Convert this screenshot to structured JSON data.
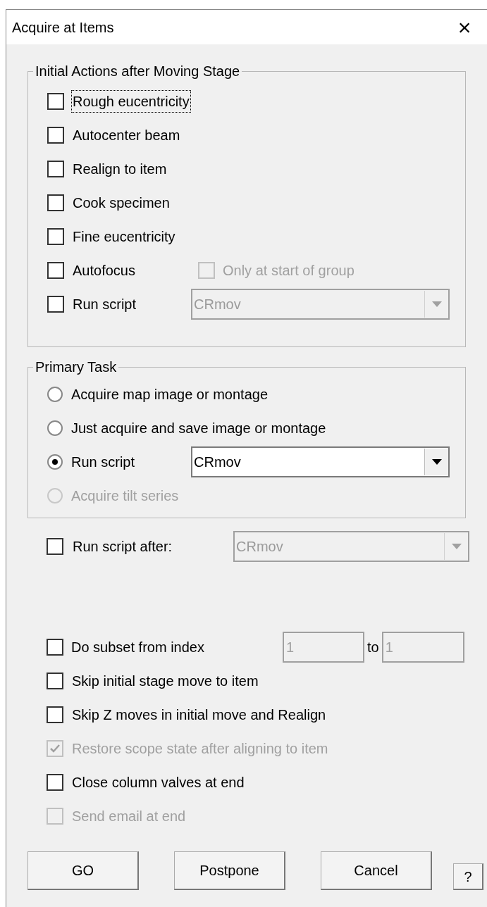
{
  "window": {
    "title": "Acquire at Items",
    "close": "×"
  },
  "initial_actions": {
    "title": "Initial Actions after Moving Stage",
    "items": [
      {
        "label": "Rough eucentricity",
        "checked": false,
        "disabled": false,
        "focused": true
      },
      {
        "label": "Autocenter beam",
        "checked": false,
        "disabled": false,
        "focused": false
      },
      {
        "label": "Realign to item",
        "checked": false,
        "disabled": false,
        "focused": false
      },
      {
        "label": "Cook specimen",
        "checked": false,
        "disabled": false,
        "focused": false
      },
      {
        "label": "Fine eucentricity",
        "checked": false,
        "disabled": false,
        "focused": false
      },
      {
        "label": "Autofocus",
        "checked": false,
        "disabled": false,
        "focused": false,
        "option": {
          "label": "Only at start of group",
          "checked": false,
          "disabled": true
        }
      },
      {
        "label": "Run script",
        "checked": false,
        "disabled": false,
        "focused": false,
        "dropdown": {
          "value": "CRmov",
          "disabled": true
        }
      }
    ]
  },
  "primary_task": {
    "title": "Primary Task",
    "options": [
      {
        "label": "Acquire map image or montage",
        "selected": false,
        "disabled": false
      },
      {
        "label": "Just acquire and save image or montage",
        "selected": false,
        "disabled": false
      },
      {
        "label": "Run script",
        "selected": true,
        "disabled": false,
        "dropdown": {
          "value": "CRmov",
          "disabled": false
        }
      },
      {
        "label": "Acquire tilt series",
        "selected": false,
        "disabled": true
      }
    ]
  },
  "run_script_after": {
    "label": "Run script after:",
    "checked": false,
    "dropdown": {
      "value": "CRmov",
      "disabled": true
    }
  },
  "subset": {
    "label": "Do subset from index",
    "checked": false,
    "from": "1",
    "to_label": "to",
    "to": "1",
    "disabled": true
  },
  "options": [
    {
      "label": "Skip initial stage move to item",
      "checked": false,
      "disabled": false
    },
    {
      "label": "Skip Z moves in initial move and Realign",
      "checked": false,
      "disabled": false
    },
    {
      "label": "Restore scope state after aligning to item",
      "checked": true,
      "disabled": true
    },
    {
      "label": "Close column valves at end",
      "checked": false,
      "disabled": false
    },
    {
      "label": "Send email at end",
      "checked": false,
      "disabled": true
    }
  ],
  "buttons": [
    {
      "label": "GO",
      "kind": "default"
    },
    {
      "label": "Postpone",
      "kind": "default"
    },
    {
      "label": "Cancel",
      "kind": "default"
    },
    {
      "label": "?",
      "kind": "help"
    }
  ]
}
